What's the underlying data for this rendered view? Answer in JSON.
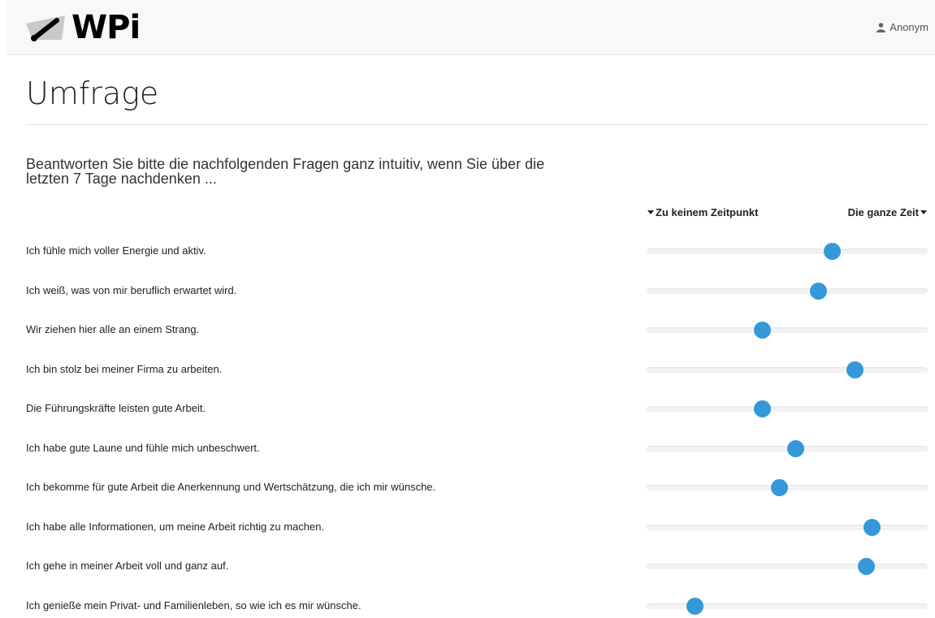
{
  "header": {
    "brand": "WPi",
    "user_label": "Anonym",
    "brand_icon": "gauge-logo-icon",
    "user_icon": "user-icon"
  },
  "page": {
    "title": "Umfrage",
    "intro": "Beantworten Sie bitte die nachfolgenden Fragen ganz intuitiv, wenn Sie über die letzten 7 Tage nachdenken ..."
  },
  "scale": {
    "min_label": "Zu keinem Zeitpunkt",
    "max_label": "Die ganze Zeit"
  },
  "colors": {
    "accent": "#3498db"
  },
  "questions": [
    {
      "label": "Ich fühle mich voller Energie und aktiv.",
      "value": 0.66
    },
    {
      "label": "Ich weiß, was von mir beruflich erwartet wird.",
      "value": 0.61
    },
    {
      "label": "Wir ziehen hier alle an einem Strang.",
      "value": 0.41
    },
    {
      "label": "Ich bin stolz bei meiner Firma zu arbeiten.",
      "value": 0.74
    },
    {
      "label": "Die Führungskräfte leisten gute Arbeit.",
      "value": 0.41
    },
    {
      "label": "Ich habe gute Laune und fühle mich unbeschwert.",
      "value": 0.53
    },
    {
      "label": "Ich bekomme für gute Arbeit die Anerkennung und Wertschätzung, die ich mir wünsche.",
      "value": 0.47
    },
    {
      "label": "Ich habe alle Informationen, um meine Arbeit richtig zu machen.",
      "value": 0.8
    },
    {
      "label": "Ich gehe in meiner Arbeit voll und ganz auf.",
      "value": 0.78
    },
    {
      "label": "Ich genieße mein Privat- und Familienleben, so wie ich es mir wünsche.",
      "value": 0.17
    }
  ]
}
